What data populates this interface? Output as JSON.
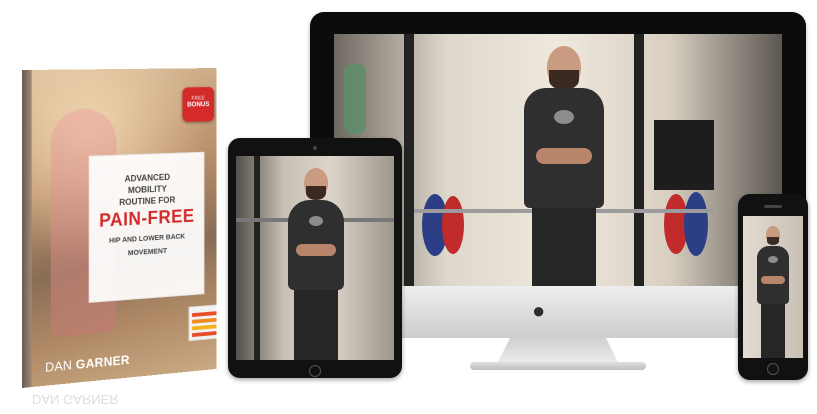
{
  "book": {
    "badge_top": "FREE",
    "badge_label": "BONUS",
    "title_line1": "ADVANCED",
    "title_line2": "MOBILITY",
    "title_line3": "ROUTINE FOR",
    "title_highlight": "PAIN-FREE",
    "subtitle_line1": "HIP AND LOWER BACK",
    "subtitle_line2": "MOVEMENT",
    "author_first": "DAN",
    "author_last": "GARNER"
  },
  "colors": {
    "accent_red": "#d42a2a",
    "device_black": "#111111",
    "imac_silver": "#dcdcdc"
  },
  "icons": {
    "imac_logo": "apple-logo-icon"
  }
}
